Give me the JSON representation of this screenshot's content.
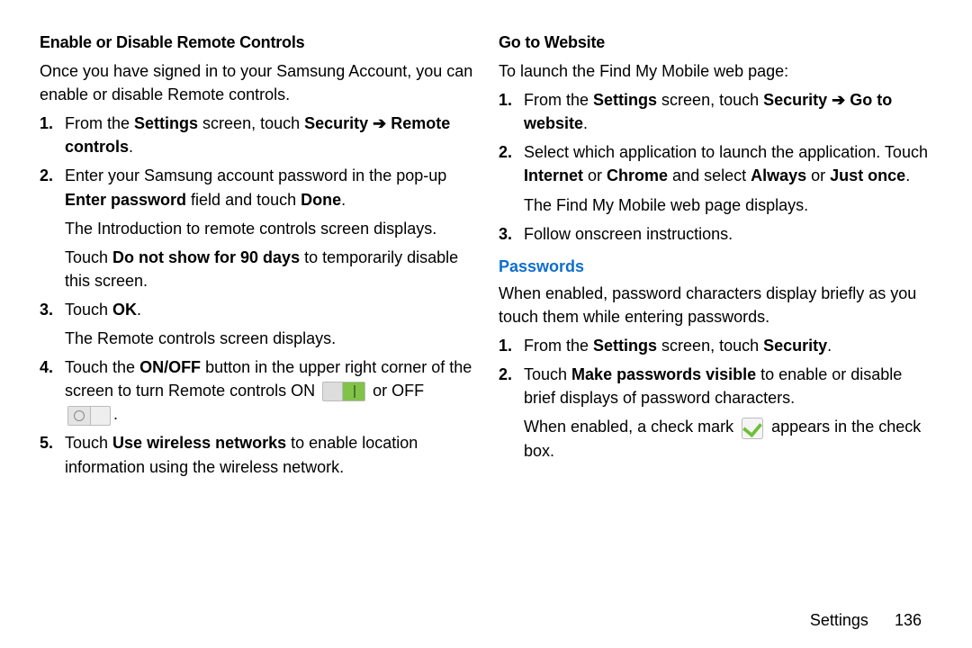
{
  "left": {
    "heading": "Enable or Disable Remote Controls",
    "intro": "Once you have signed in to your Samsung Account, you can enable or disable Remote controls.",
    "step1_a": "From the ",
    "step1_b": "Settings",
    "step1_c": " screen, touch ",
    "step1_d": "Security",
    "step1_arrow": " ➔ ",
    "step1_e": "Remote controls",
    "step1_f": ".",
    "step2_a": "Enter your Samsung account password in the pop-up ",
    "step2_b": "Enter password",
    "step2_c": " field and touch ",
    "step2_d": "Done",
    "step2_e": ".",
    "step2_sub1": "The Introduction to remote controls screen displays.",
    "step2_sub2a": "Touch ",
    "step2_sub2b": "Do not show for 90 days",
    "step2_sub2c": " to temporarily disable this screen.",
    "step3_a": "Touch ",
    "step3_b": "OK",
    "step3_c": ".",
    "step3_sub": "The Remote controls screen displays.",
    "step4_a": "Touch the ",
    "step4_b": "ON/OFF",
    "step4_c": " button in the upper right corner of the screen to turn Remote controls ON ",
    "step4_d": " or OFF ",
    "step4_e": ".",
    "step5_a": "Touch ",
    "step5_b": "Use wireless networks",
    "step5_c": " to enable location information using the wireless network."
  },
  "right": {
    "heading": "Go to Website",
    "intro": "To launch the Find My Mobile web page:",
    "g1_a": "From the ",
    "g1_b": "Settings",
    "g1_c": " screen, touch ",
    "g1_d": "Security",
    "g1_arrow": " ➔ ",
    "g1_e": "Go to website",
    "g1_f": ".",
    "g2_a": "Select which application to launch the application. Touch ",
    "g2_b": "Internet",
    "g2_c": " or ",
    "g2_d": "Chrome",
    "g2_e": " and select ",
    "g2_f": "Always",
    "g2_g": " or ",
    "g2_h": "Just once",
    "g2_i": ".",
    "g2_sub": "The Find My Mobile web page displays.",
    "g3": "Follow onscreen instructions.",
    "pw_heading": "Passwords",
    "pw_intro": "When enabled, password characters display briefly as you touch them while entering passwords.",
    "p1_a": "From the ",
    "p1_b": "Settings",
    "p1_c": " screen, touch ",
    "p1_d": "Security",
    "p1_e": ".",
    "p2_a": "Touch ",
    "p2_b": "Make passwords visible",
    "p2_c": " to enable or disable brief displays of password characters.",
    "p2_sub_a": "When enabled, a check mark ",
    "p2_sub_b": " appears in the check box."
  },
  "nums": {
    "n1": "1.",
    "n2": "2.",
    "n3": "3.",
    "n4": "4.",
    "n5": "5."
  },
  "footer": {
    "section": "Settings",
    "page": "136"
  }
}
